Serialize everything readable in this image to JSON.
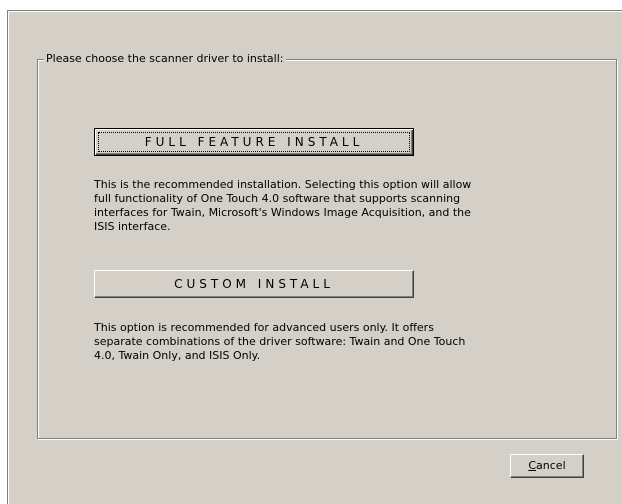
{
  "dialog": {
    "group_title": "Please choose the scanner driver to install:",
    "full_feature_button": "FULL FEATURE INSTALL",
    "full_feature_description": "This is the recommended installation. Selecting this option will allow full functionality of One Touch 4.0 software that supports scanning interfaces for Twain, Microsoft's Windows Image Acquisition, and the ISIS interface.",
    "custom_button": "CUSTOM INSTALL",
    "custom_description": "This option is recommended for advanced users only. It offers separate combinations of the driver software: Twain and One Touch 4.0, Twain Only, and ISIS Only.",
    "cancel_button": {
      "mnemonic": "C",
      "rest": "ancel"
    }
  }
}
